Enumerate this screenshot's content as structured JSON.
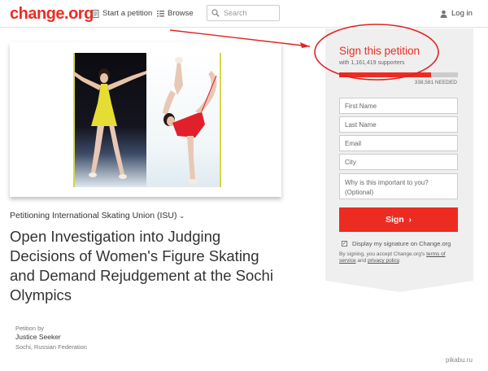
{
  "header": {
    "logo": "change.org",
    "start_petition": "Start a petition",
    "browse": "Browse",
    "search_placeholder": "Search",
    "login": "Log in",
    "icons": {
      "start": "document-icon",
      "browse": "list-icon",
      "search": "search-icon",
      "login": "user-icon"
    }
  },
  "petition": {
    "petitioning": "Petitioning International Skating Union (ISU)",
    "title": "Open Investigation into Judging Decisions of Women's Figure Skating and Demand Rejudgement at the Sochi Olympics",
    "petition_by": "Petition by",
    "author": "Justice Seeker",
    "location": "Sochi, Russian Federation"
  },
  "sign_panel": {
    "title": "Sign this petition",
    "supporters": "with 1,161,419 supporters",
    "needed": "338,581 NEEDED",
    "progress_fraction": 0.774,
    "fields": {
      "first_name": "First Name",
      "last_name": "Last Name",
      "email": "Email",
      "city": "City",
      "why": "Why is this important to you? (Optional)"
    },
    "sign_button": "Sign",
    "display_signature": "Display my signature on Change.org",
    "consent_prefix": "By signing, you accept Change.org's ",
    "terms": "terms of service",
    "consent_and": " and ",
    "privacy": "privacy policy",
    "consent_suffix": "."
  },
  "colors": {
    "brand": "#ec2c22",
    "panel": "#efefef"
  },
  "watermark": "pikabu.ru"
}
